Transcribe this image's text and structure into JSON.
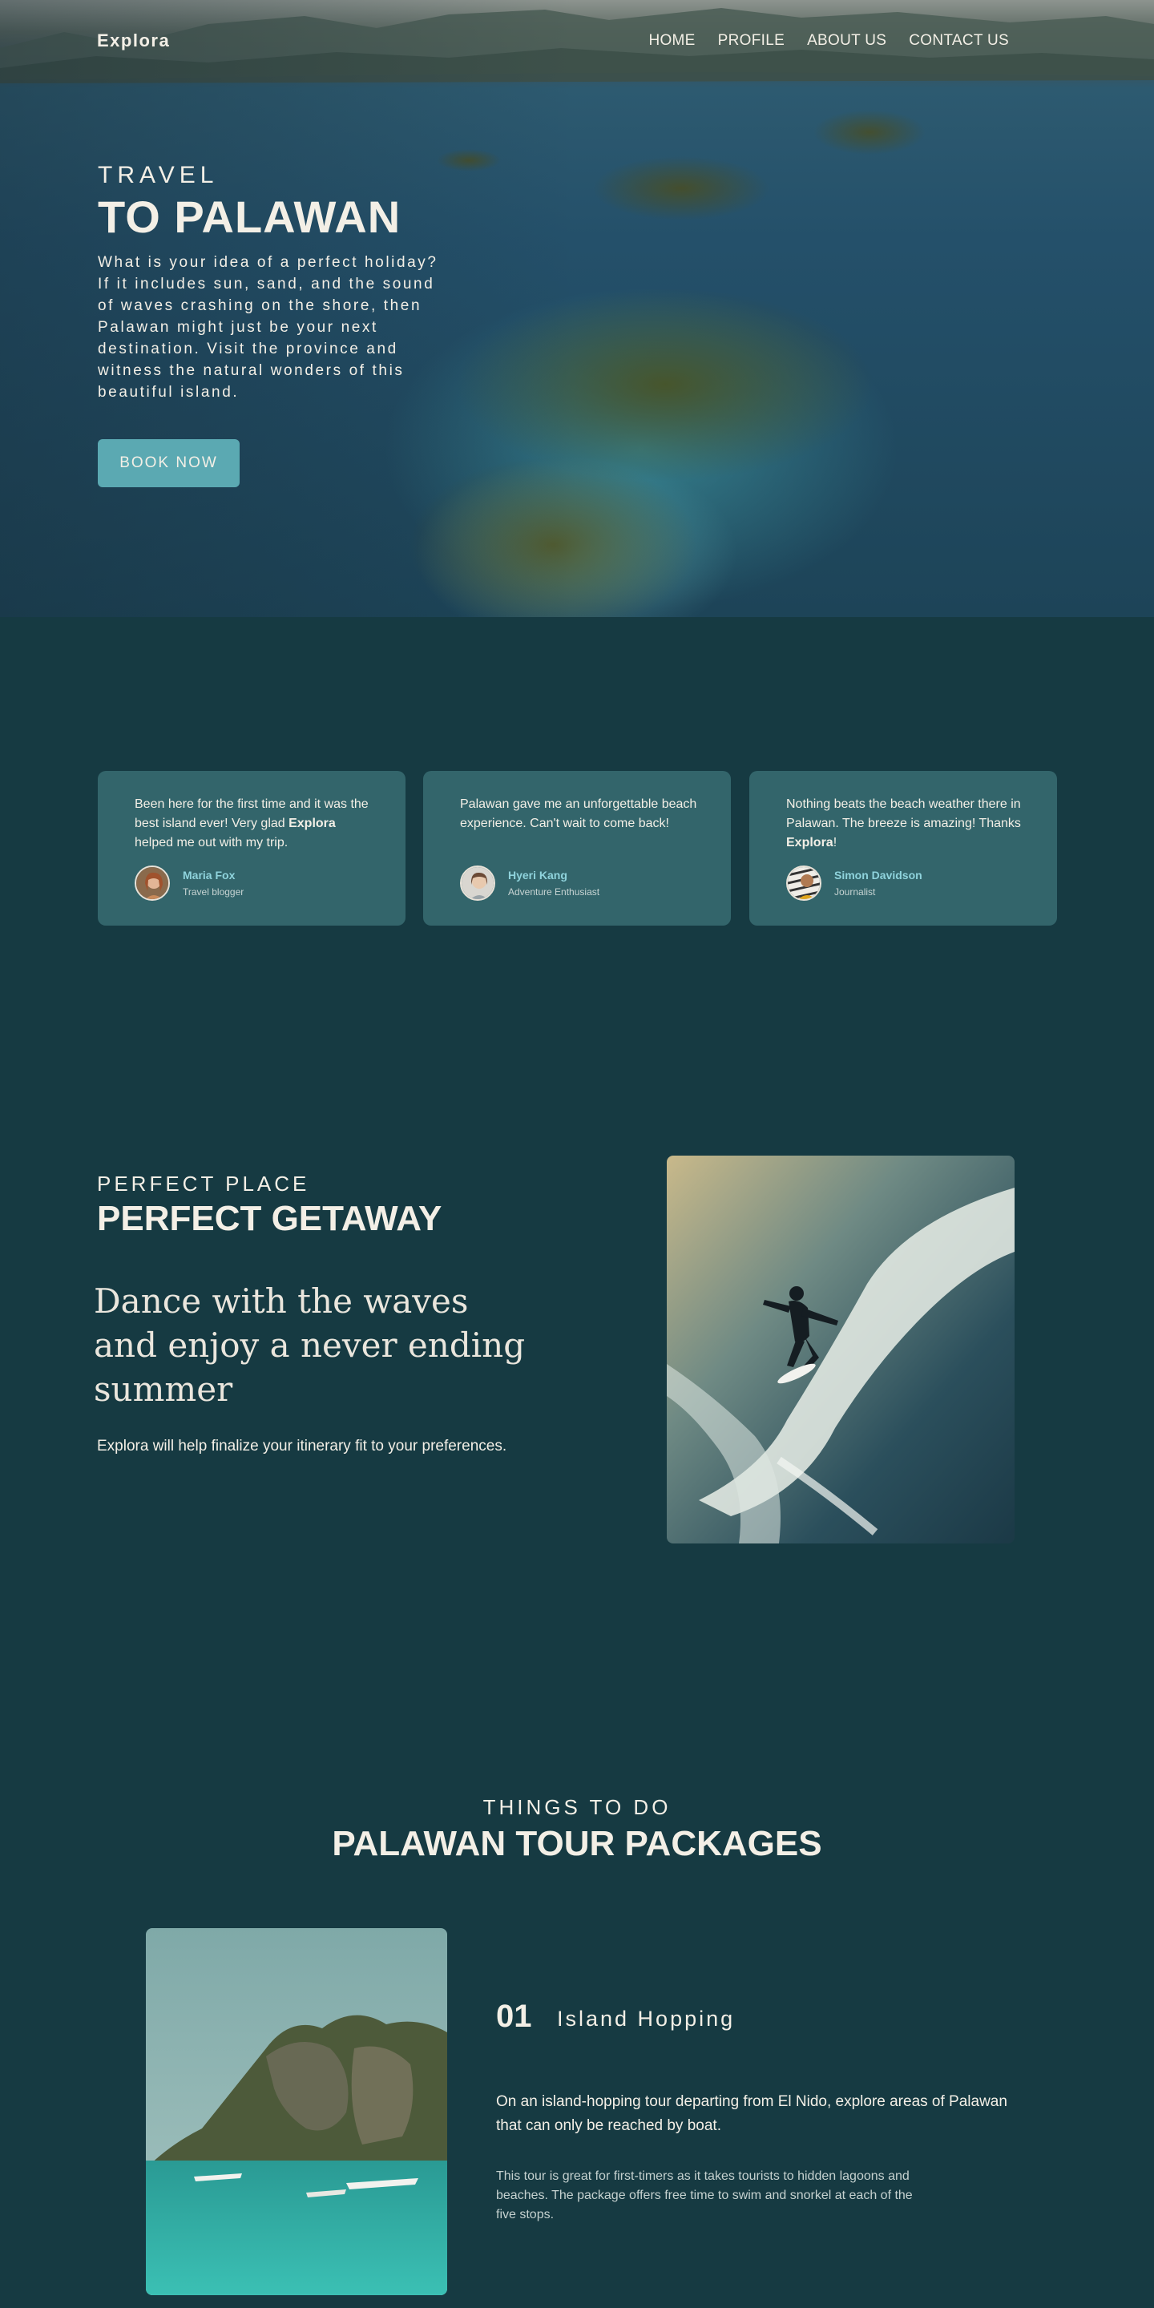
{
  "brand": {
    "logo": "Explora"
  },
  "nav": {
    "items": [
      "HOME",
      "PROFILE",
      "ABOUT US",
      "CONTACT US"
    ]
  },
  "hero": {
    "subtitle": "TRAVEL",
    "title": "TO PALAWAN",
    "description": "What is your idea of a perfect holiday? If it includes sun, sand, and the sound of waves crashing on the shore, then Palawan might just be your next destination. Visit the province and witness the natural wonders of this beautiful island.",
    "cta": "BOOK NOW"
  },
  "testimonials": [
    {
      "before": "Been here for the first time and it was the best island ever! Very glad ",
      "bold": "Explora",
      "after": " helped me out with my trip.",
      "name": "Maria Fox",
      "role": "Travel blogger"
    },
    {
      "before": "Palawan gave me an unforgettable beach experience. Can't wait to come back!",
      "bold": "",
      "after": "",
      "name": "Hyeri Kang",
      "role": "Adventure Enthusiast"
    },
    {
      "before": "Nothing beats the beach weather there in Palawan. The breeze is amazing! Thanks ",
      "bold": "Explora",
      "after": "!",
      "name": "Simon Davidson",
      "role": "Journalist"
    }
  ],
  "getaway": {
    "subtitle": "PERFECT PLACE",
    "title": "PERFECT GETAWAY",
    "quote": "Dance with the waves and enjoy a never ending summer",
    "description": "Explora will help finalize your itinerary fit to your preferences."
  },
  "tours": {
    "subtitle": "THINGS TO DO",
    "title": "PALAWAN TOUR PACKAGES",
    "packages": [
      {
        "number": "01",
        "name": "Island Hopping",
        "lead": "On an island-hopping tour departing from El Nido, explore areas of Palawan that can only be reached by boat.",
        "description": "This tour is great for first-timers as it takes tourists to hidden lagoons and beaches. The package offers free time to swim and snorkel at each of the five stops."
      }
    ]
  },
  "colors": {
    "background": "#163a42",
    "card": "#33656b",
    "accent": "#5ba9b2",
    "name_accent": "#8fd3dc",
    "text": "#f3efe6"
  }
}
